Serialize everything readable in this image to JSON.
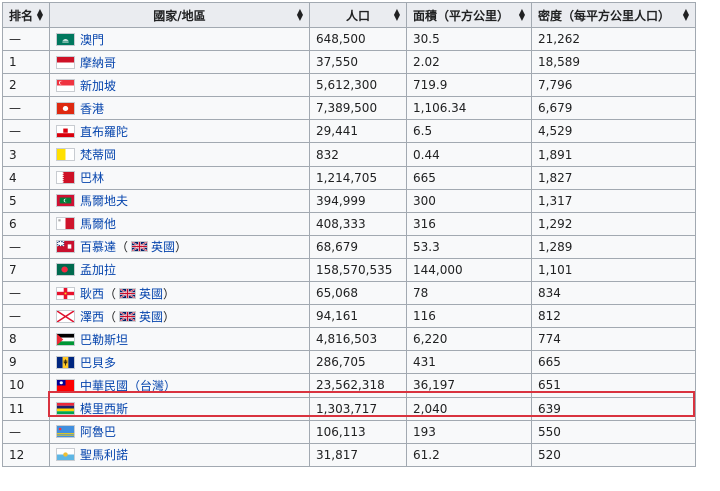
{
  "headers": {
    "rank": "排名",
    "country": "國家/地區",
    "population": "人口",
    "area": "面積（平方公里）",
    "density": "密度（每平方公里人口）"
  },
  "rows": [
    {
      "rank": "—",
      "name": "澳門",
      "pop": "648,500",
      "area": "30.5",
      "density": "21,262",
      "flag": "macau-flag-icon"
    },
    {
      "rank": "1",
      "name": "摩納哥",
      "pop": "37,550",
      "area": "2.02",
      "density": "18,589",
      "flag": "monaco-flag-icon"
    },
    {
      "rank": "2",
      "name": "新加坡",
      "pop": "5,612,300",
      "area": "719.9",
      "density": "7,796",
      "flag": "singapore-flag-icon"
    },
    {
      "rank": "—",
      "name": "香港",
      "pop": "7,389,500",
      "area": "1,106.34",
      "density": "6,679",
      "flag": "hongkong-flag-icon"
    },
    {
      "rank": "—",
      "name": "直布羅陀",
      "pop": "29,441",
      "area": "6.5",
      "density": "4,529",
      "flag": "gibraltar-flag-icon"
    },
    {
      "rank": "3",
      "name": "梵蒂岡",
      "pop": "832",
      "area": "0.44",
      "density": "1,891",
      "flag": "vatican-flag-icon"
    },
    {
      "rank": "4",
      "name": "巴林",
      "pop": "1,214,705",
      "area": "665",
      "density": "1,827",
      "flag": "bahrain-flag-icon"
    },
    {
      "rank": "5",
      "name": "馬爾地夫",
      "pop": "394,999",
      "area": "300",
      "density": "1,317",
      "flag": "maldives-flag-icon"
    },
    {
      "rank": "6",
      "name": "馬爾他",
      "pop": "408,333",
      "area": "316",
      "density": "1,292",
      "flag": "malta-flag-icon"
    },
    {
      "rank": "—",
      "name": "百慕達",
      "paren_open": "（",
      "sub": "英國",
      "paren_close": "）",
      "pop": "68,679",
      "area": "53.3",
      "density": "1,289",
      "flag": "bermuda-flag-icon"
    },
    {
      "rank": "7",
      "name": "孟加拉",
      "pop": "158,570,535",
      "area": "144,000",
      "density": "1,101",
      "flag": "bangladesh-flag-icon"
    },
    {
      "rank": "—",
      "name": "耿西",
      "paren_open": "（",
      "sub": "英國",
      "paren_close": "）",
      "pop": "65,068",
      "area": "78",
      "density": "834",
      "flag": "guernsey-flag-icon"
    },
    {
      "rank": "—",
      "name": "澤西",
      "paren_open": "（",
      "sub": "英國",
      "paren_close": "）",
      "pop": "94,161",
      "area": "116",
      "density": "812",
      "flag": "jersey-flag-icon"
    },
    {
      "rank": "8",
      "name": "巴勒斯坦",
      "pop": "4,816,503",
      "area": "6,220",
      "density": "774",
      "flag": "palestine-flag-icon"
    },
    {
      "rank": "9",
      "name": "巴貝多",
      "pop": "286,705",
      "area": "431",
      "density": "665",
      "flag": "barbados-flag-icon"
    },
    {
      "rank": "10",
      "name": "中華民國（台灣）",
      "pop": "23,562,318",
      "area": "36,197",
      "density": "651",
      "flag": "taiwan-flag-icon"
    },
    {
      "rank": "11",
      "name": "模里西斯",
      "pop": "1,303,717",
      "area": "2,040",
      "density": "639",
      "flag": "mauritius-flag-icon"
    },
    {
      "rank": "—",
      "name": "阿魯巴",
      "pop": "106,113",
      "area": "193",
      "density": "550",
      "flag": "aruba-flag-icon"
    },
    {
      "rank": "12",
      "name": "聖馬利諾",
      "pop": "31,817",
      "area": "61.2",
      "density": "520",
      "flag": "sanmarino-flag-icon"
    }
  ],
  "colors": {
    "header_bg": "#eaecf0",
    "cell_bg": "#f8f9fa",
    "border": "#a2a9b1",
    "link": "#0645ad",
    "highlight": "#d9333f"
  },
  "sort_icon": "sort-arrows-icon"
}
